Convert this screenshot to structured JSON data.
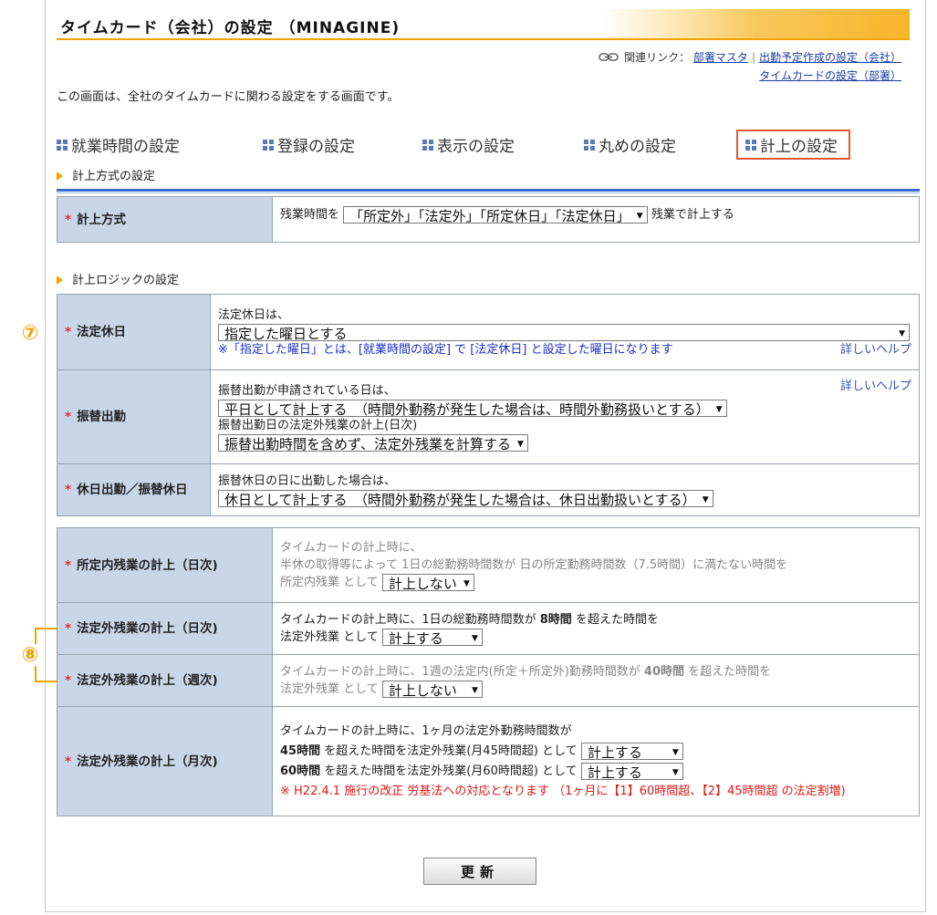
{
  "title": "タイムカード（会社）の設定 （MINAGINE)",
  "related": {
    "label": "関連リンク：",
    "links": [
      "部署マスタ",
      "出勤予定作成の設定（会社）",
      "タイムカードの設定（部署）"
    ],
    "sep": "|"
  },
  "description": "この画面は、全社のタイムカードに関わる設定をする画面です。",
  "tabs": [
    "就業時間の設定",
    "登録の設定",
    "表示の設定",
    "丸めの設定",
    "計上の設定"
  ],
  "sections": {
    "method": "計上方式の設定",
    "logic": "計上ロジックの設定"
  },
  "calc_method": {
    "label": "計上方式",
    "prefix": "残業時間を",
    "select": "「所定外」「法定外」「所定休日」「法定休日」",
    "suffix": "残業で計上する"
  },
  "legal_holiday": {
    "label": "法定休日",
    "intro": "法定休日は、",
    "select": "指定した曜日とする",
    "note": "※「指定した曜日」とは、[就業時間の設定] で [法定休日] と設定した曜日になります",
    "help": "詳しいヘルプ"
  },
  "substitute_work": {
    "label": "振替出勤",
    "intro1": "振替出勤が申請されている日は、",
    "select1": "平日として計上する　（時間外勤務が発生した場合は、時間外勤務扱いとする）",
    "intro2": "振替出勤日の法定外残業の計上(日次)",
    "select2": "振替出勤時間を含めず、法定外残業を計算する",
    "help": "詳しいヘルプ"
  },
  "holiday_work": {
    "label": "休日出勤／振替休日",
    "intro": "振替休日の日に出勤した場合は、",
    "select": "休日として計上する　（時間外勤務が発生した場合は、休日出勤扱いとする）"
  },
  "in_overtime_daily": {
    "label": "所定内残業の計上（日次)",
    "line1": "タイムカードの計上時に、",
    "line2": "半休の取得等によって 1日の総勤務時間数が 日の所定勤務時間数（7.5時間）に満たない時間を",
    "line3": "所定内残業 として",
    "select": "計上しない"
  },
  "legal_overtime_daily": {
    "label": "法定外残業の計上（日次)",
    "line1a": "タイムカードの計上時に、1日の総勤務時間数が",
    "hours": "8時間",
    "line1b": "を超えた時間を",
    "line2": "法定外残業 として",
    "select": "計上する"
  },
  "legal_overtime_weekly": {
    "label": "法定外残業の計上（週次)",
    "line1a": "タイムカードの計上時に、1週の法定内(所定＋所定外)勤務時間数が",
    "hours": "40時間",
    "line1b": "を超えた時間を",
    "line2": "法定外残業 として",
    "select": "計上しない"
  },
  "legal_overtime_monthly": {
    "label": "法定外残業の計上（月次)",
    "line1": "タイムカードの計上時に、1ヶ月の法定外勤務時間数が",
    "h45": "45時間",
    "l45": "を超えた時間を法定外残業(月45時間超) として",
    "select45": "計上する",
    "h60": "60時間",
    "l60": "を超えた時間を法定外残業(月60時間超) として",
    "select60": "計上する",
    "note": "※ H22.4.1 施行の改正 労基法への対応となります （1ヶ月に【1】60時間超、【2】45時間超 の法定割増)"
  },
  "markers": {
    "m7": "⑦",
    "m8": "⑧"
  },
  "update_button": "更新",
  "colors": {
    "accent": "#f0a300",
    "label_bg": "#c9d6e8",
    "required": "#e5292b",
    "active_tab_border": "#e8582a"
  }
}
